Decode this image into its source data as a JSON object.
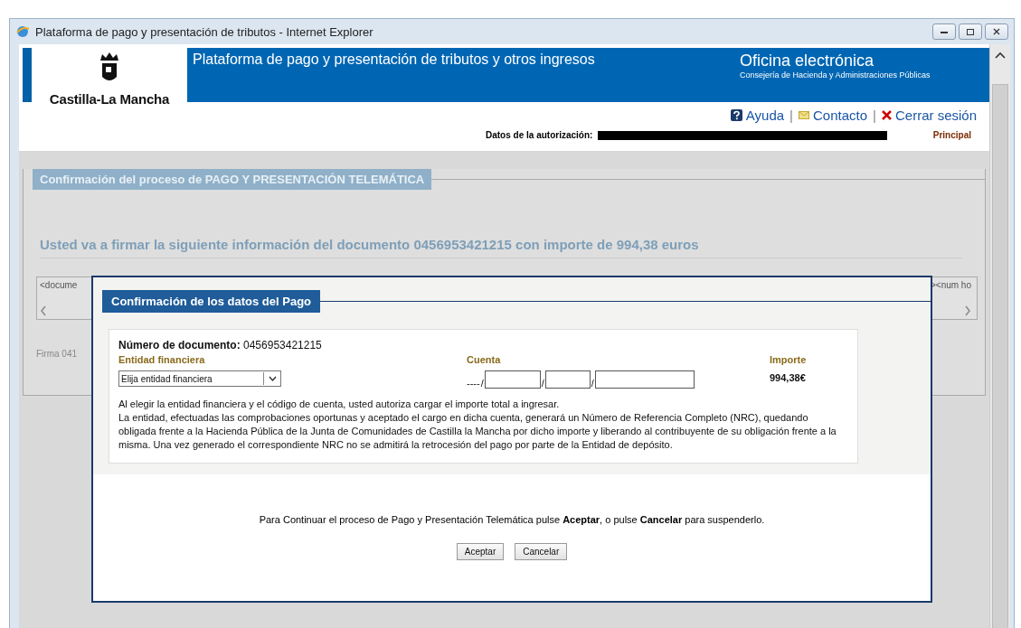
{
  "window": {
    "title": "Plataforma de pago y presentación de tributos - Internet Explorer"
  },
  "header": {
    "brand": "Castilla-La Mancha",
    "title": "Plataforma de pago y presentación de tributos y otros ingresos",
    "office": "Oficina electrónica",
    "office_subtitle": "Consejería de Hacienda y Administraciones Públicas"
  },
  "links": [
    {
      "kind": "help",
      "label": "Ayuda"
    },
    {
      "kind": "mail",
      "label": "Contacto",
      "separator": "|"
    },
    {
      "kind": "close",
      "label": "Cerrar sesión",
      "separator": "|"
    }
  ],
  "authorization": {
    "label": "Datos de la autorización:",
    "role": "Principal"
  },
  "background": {
    "legend": "Confirmación del proceso de PAGO Y PRESENTACIÓN TELEMÁTICA",
    "message": "Usted va a firmar la siguiente información del documento 0456953421215 con importe de 994,38 euros",
    "doc_left": "<docume",
    "doc_right": "><num ho",
    "signature": "Firma 041"
  },
  "dialog": {
    "legend": "Confirmación de los datos del Pago",
    "document_label": "Número de documento:",
    "document_number": "0456953421215",
    "entity_label": "Entidad financiera",
    "entity_select": "Elija entidad financiera",
    "account_label": "Cuenta",
    "account_prefix": "----",
    "account_fields": [
      {
        "separator": "/"
      },
      {
        "separator": "/"
      },
      {
        "separator": "/"
      }
    ],
    "amount_label": "Importe",
    "amount": "994,38€",
    "paragraphs": [
      "Al elegir la entidad financiera y el código de cuenta, usted autoriza cargar el importe total a ingresar.",
      "La entidad, efectuadas las comprobaciones oportunas y aceptado el cargo en dicha cuenta, generará un Número de Referencia Completo (NRC), quedando obligada frente a la Hacienda Pública de la Junta de Comunidades de Castilla la Mancha por dicho importe y liberando al contribuyente de su obligación frente a la misma. Una vez generado el correspondiente NRC no se admitirá la retrocesión del pago por parte de la Entidad de depósito."
    ],
    "instruction": "Para Continuar el proceso de Pago y Presentación Telemática pulse **Aceptar**, o pulse **Cancelar** para suspenderlo.",
    "buttons": [
      "Aceptar",
      "Cancelar"
    ]
  }
}
